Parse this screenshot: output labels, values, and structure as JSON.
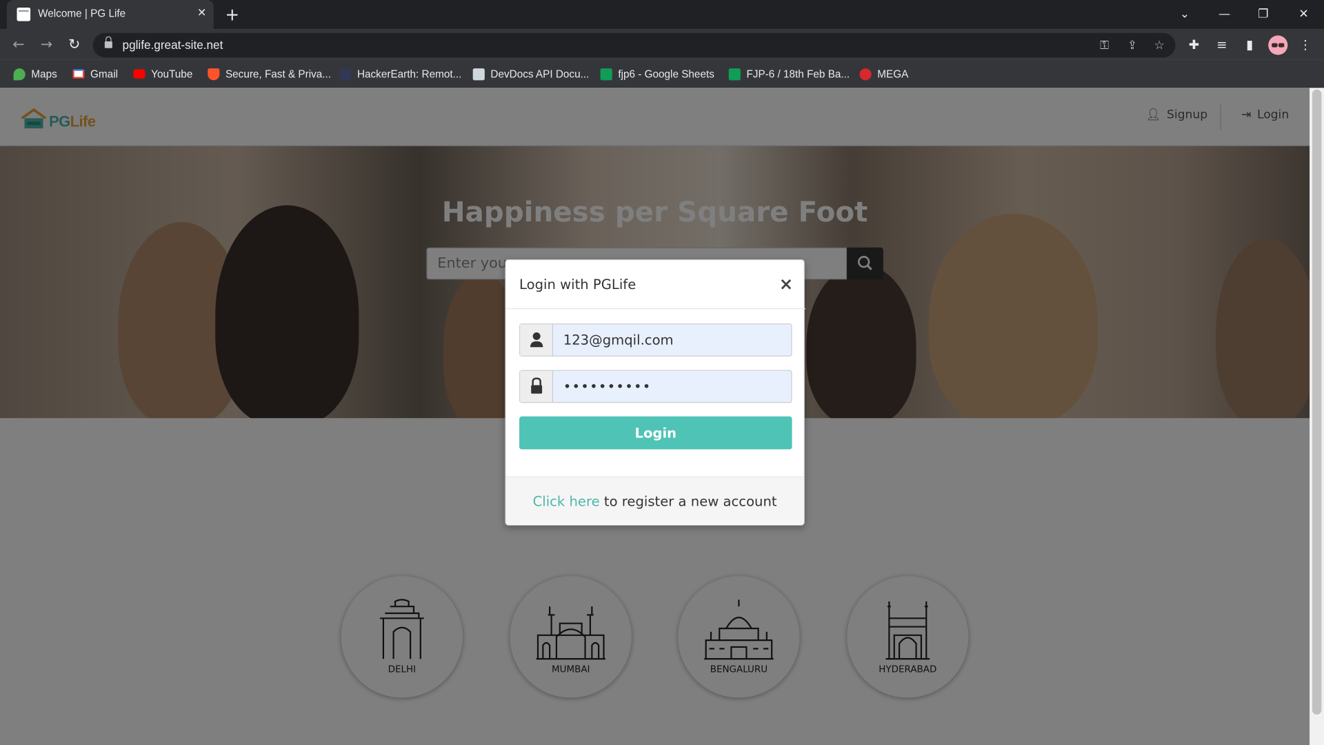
{
  "browser": {
    "tab_title": "Welcome | PG Life",
    "url": "pglife.great-site.net",
    "bookmarks": [
      {
        "label": "Maps",
        "icon": "maps-icon",
        "color": "#4caf50"
      },
      {
        "label": "Gmail",
        "icon": "gmail-icon",
        "color": "#ea4335"
      },
      {
        "label": "YouTube",
        "icon": "youtube-icon",
        "color": "#ff0000"
      },
      {
        "label": "Secure, Fast & Priva...",
        "icon": "brave-icon",
        "color": "#fb542b"
      },
      {
        "label": "HackerEarth: Remot...",
        "icon": "hackerearth-icon",
        "color": "#323754"
      },
      {
        "label": "DevDocs API Docu...",
        "icon": "devdocs-icon",
        "color": "#cfd8dc"
      },
      {
        "label": "fjp6 - Google Sheets",
        "icon": "sheets-icon",
        "color": "#0f9d58"
      },
      {
        "label": "FJP-6 / 18th Feb Ba...",
        "icon": "sheets-icon",
        "color": "#0f9d58"
      },
      {
        "label": "MEGA",
        "icon": "mega-icon",
        "color": "#d9272e"
      }
    ]
  },
  "site": {
    "logo_pg": "PG",
    "logo_life": "Life",
    "nav": {
      "signup": "Signup",
      "login": "Login"
    },
    "hero_title": "Happiness per Square Foot",
    "search_placeholder": "Enter your",
    "cities": [
      "DELHI",
      "MUMBAI",
      "BENGALURU",
      "HYDERABAD"
    ]
  },
  "modal": {
    "title": "Login with PGLife",
    "close": "×",
    "email_value": "123@gmqil.com",
    "password_value": "••••••••••",
    "login_button": "Login",
    "footer_link": "Click here",
    "footer_text": " to register a new account"
  },
  "colors": {
    "accent": "#4fc3b5",
    "logo_green": "#4db6ac",
    "logo_orange": "#e8a33d"
  }
}
